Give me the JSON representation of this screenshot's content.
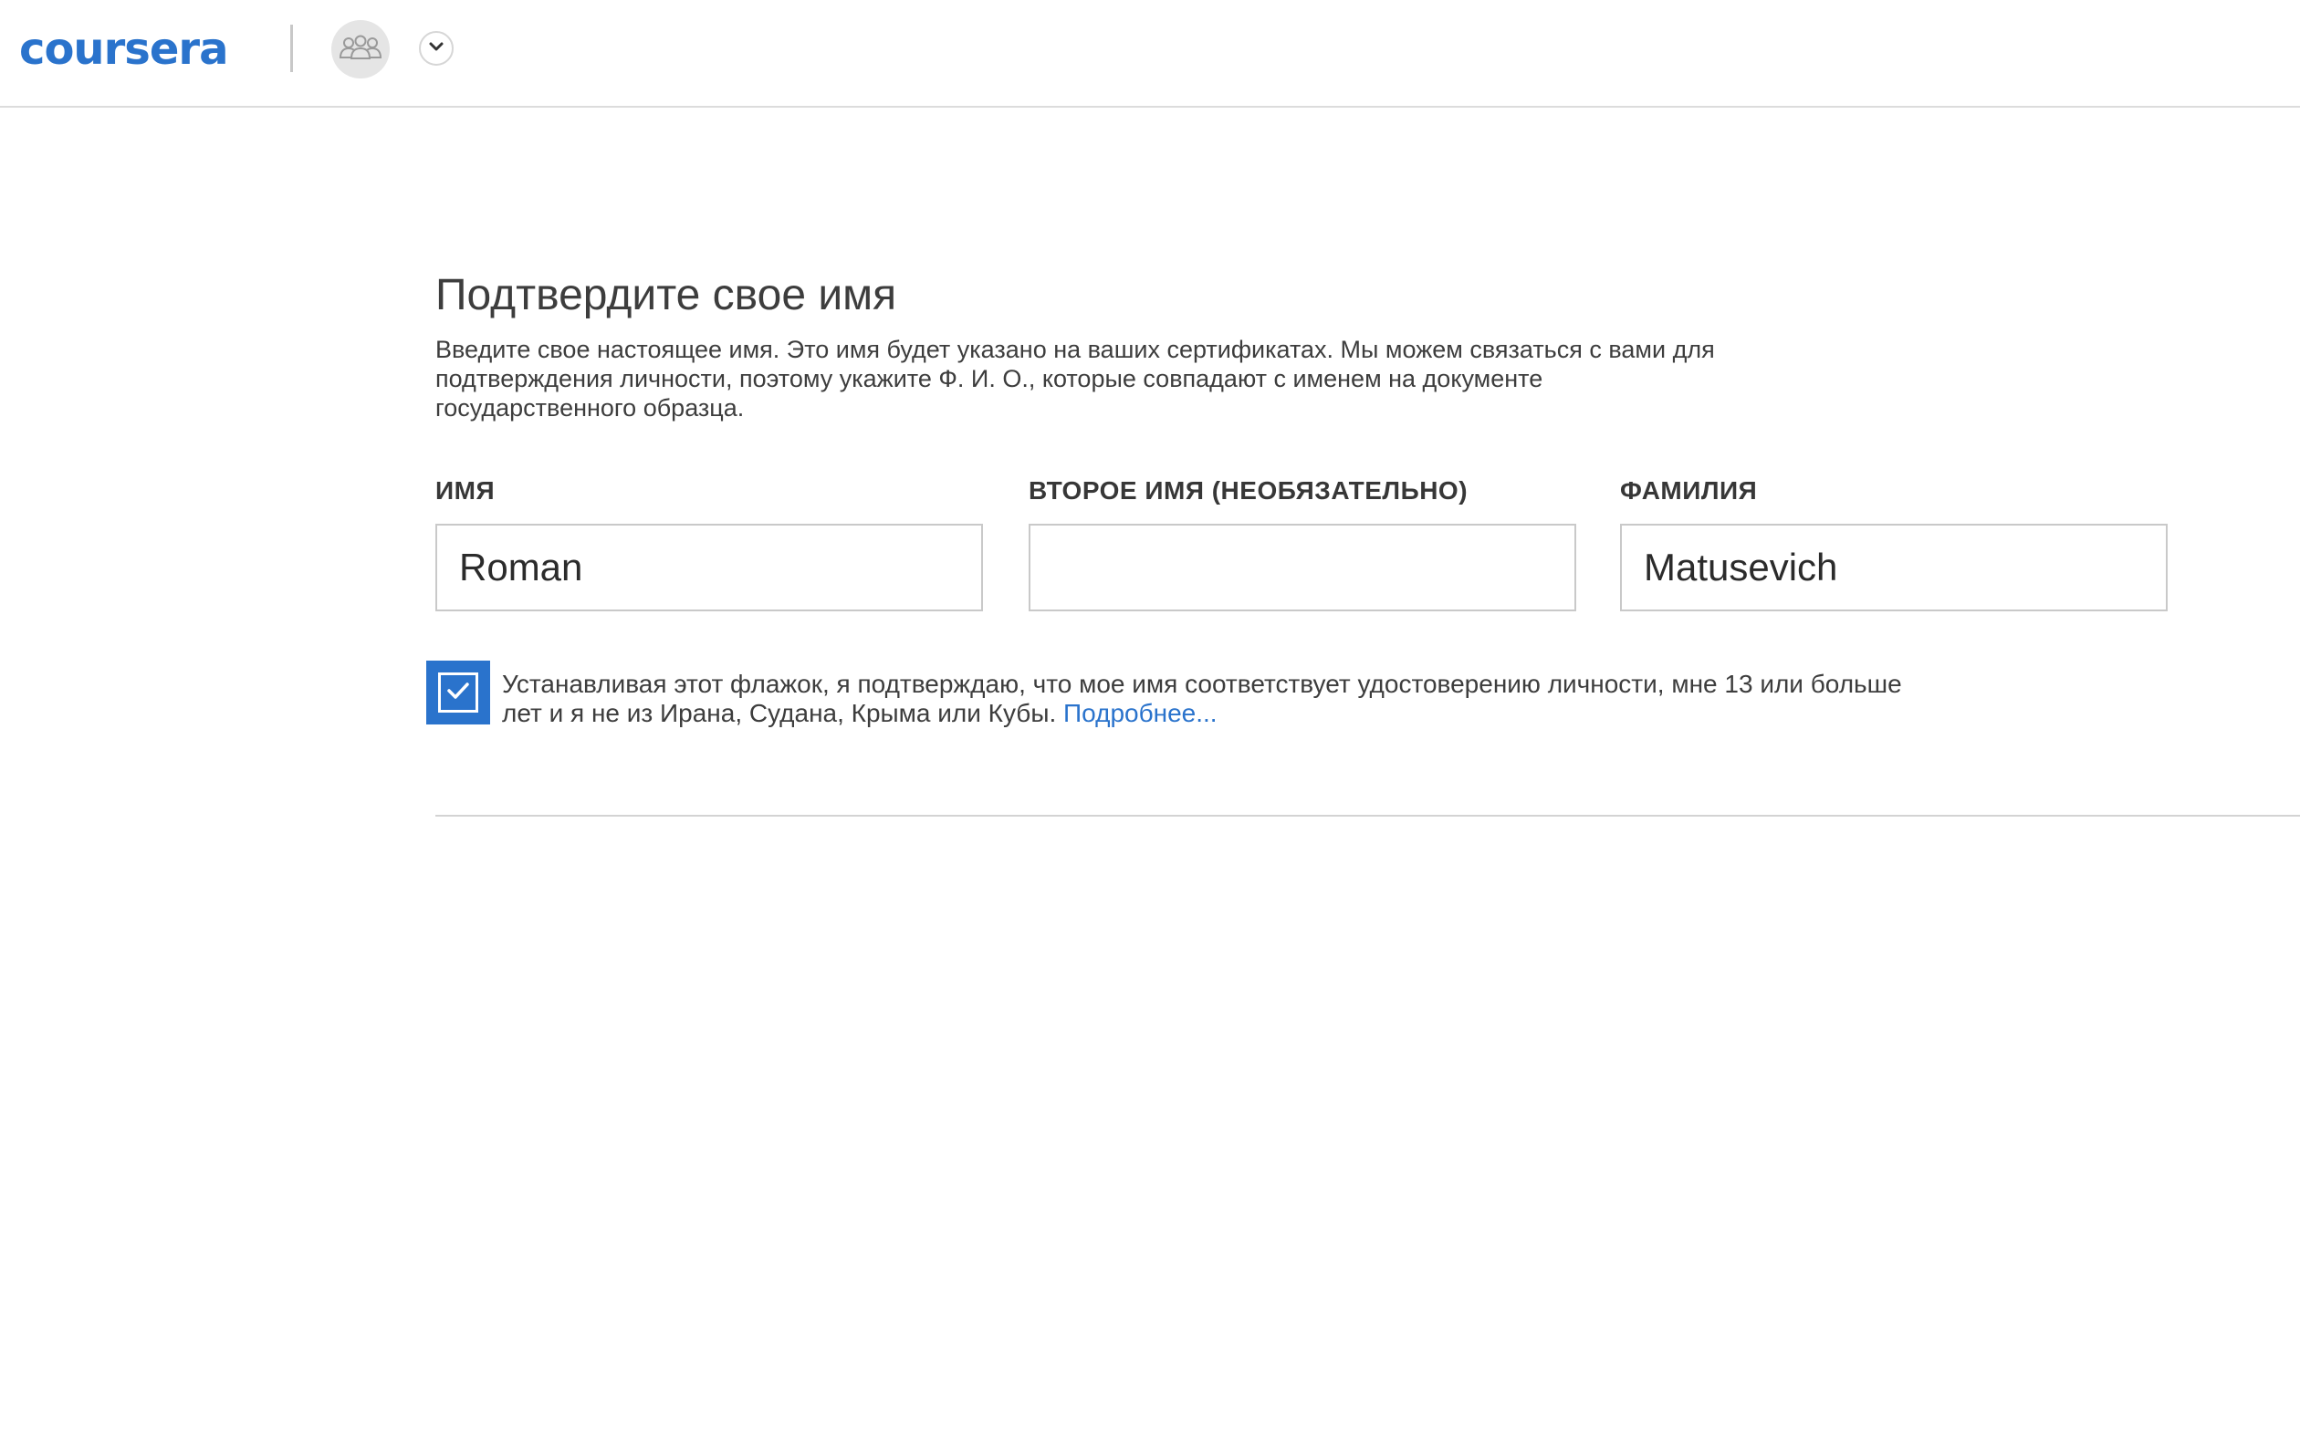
{
  "header": {
    "logo_text": "coursera",
    "avatar_icon": "group-users-icon",
    "menu_icon": "chevron-down-icon"
  },
  "form": {
    "title": "Подтвердите свое имя",
    "intro": "Введите свое настоящее имя. Это имя будет указано на ваших сертификатах. Мы можем связаться с вами для подтверждения личности, поэтому укажите Ф. И. О., которые совпадают с именем на документе государственного образца.",
    "fields": [
      {
        "label": "ИМЯ",
        "value": "Roman"
      },
      {
        "label": "ВТОРОЕ ИМЯ (НЕОБЯЗАТЕЛЬНО)",
        "value": ""
      },
      {
        "label": "ФАМИЛИЯ",
        "value": "Matusevich"
      }
    ],
    "consent": {
      "checked": true,
      "text": "Устанавливая этот флажок, я подтверждаю, что мое имя соответствует удостоверению личности, мне 13 или больше лет и я не из Ирана, Судана, Крыма или Кубы.",
      "link_text": "Подробнее..."
    }
  },
  "colors": {
    "brand": "#2a73cc",
    "text": "#3d3d3d",
    "border": "#c9c9c9"
  }
}
